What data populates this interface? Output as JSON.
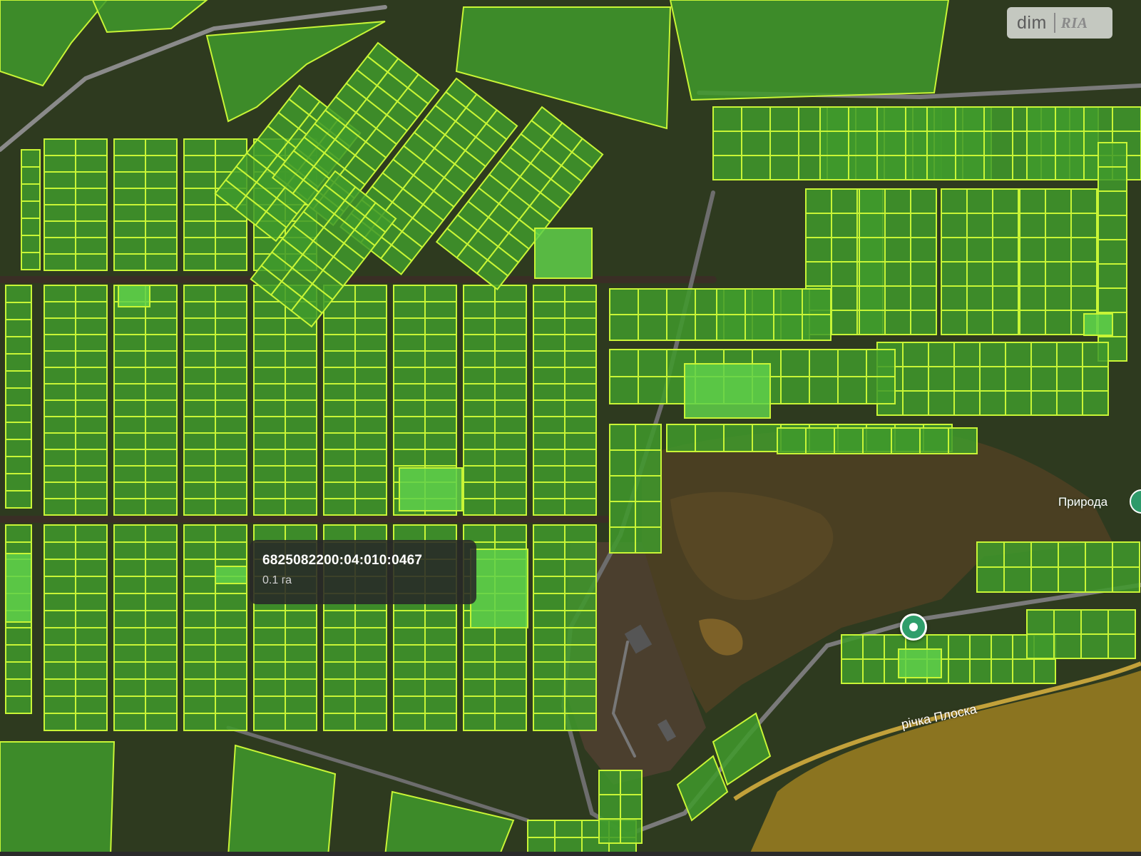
{
  "map": {
    "type": "cadastral-parcel-map",
    "base_layer": "satellite",
    "colors": {
      "parcel_fill": "#3f9a2c",
      "parcel_stroke": "#c8f536",
      "highlight_fill": "#5fd04a",
      "road": "#3a2e25",
      "forest": "#3f3a22",
      "reservoir": "#8b7420"
    }
  },
  "tooltip": {
    "cadastral_number": "6825082200:04:010:0467",
    "area": "0.1 га"
  },
  "watermark": {
    "dim": "dim",
    "ria": "RIA"
  },
  "labels": {
    "place": "Природа",
    "river": "річка Плоска"
  },
  "markers": [
    {
      "icon": "location-pin-icon"
    },
    {
      "icon": "place-pin-icon"
    }
  ]
}
